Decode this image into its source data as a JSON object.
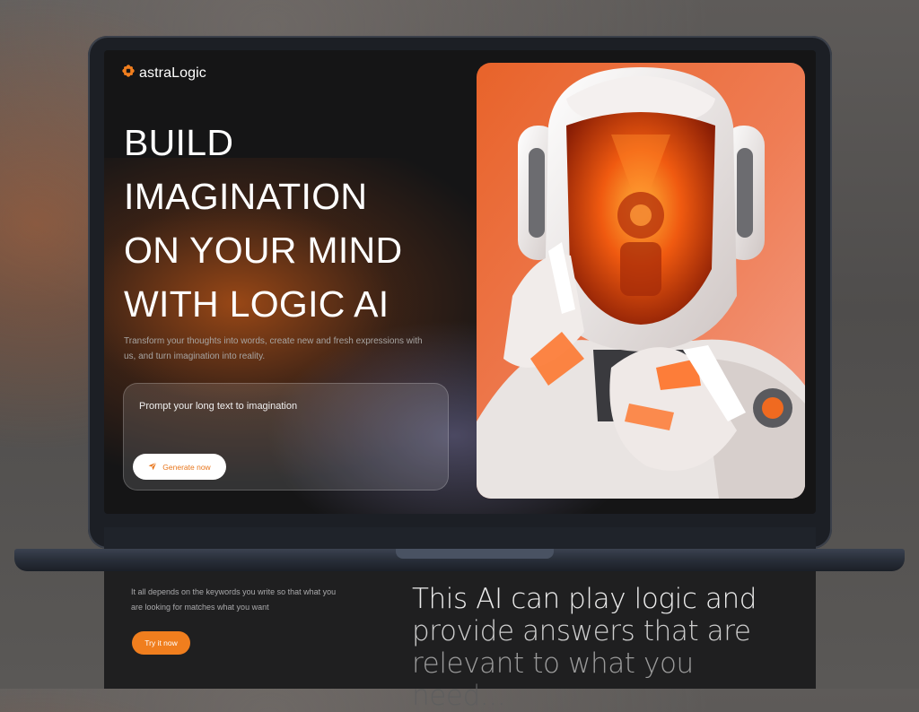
{
  "app": {
    "logo_text": "astraLogic",
    "logo_icon": "flower-sparkle-icon",
    "brand_color": "#f07e1e"
  },
  "hero": {
    "headline_lines": [
      "BUILD",
      "IMAGINATION",
      "ON YOUR MIND",
      "WITH LOGIC AI"
    ],
    "subtext": "Transform your thoughts into words, create new and fresh expressions with us, and turn imagination into reality.",
    "prompt_text": "Prompt your long text to imagination",
    "generate_label": "Generate now",
    "generate_icon": "send-icon"
  },
  "below": {
    "description": "It all depends on the keywords you write so that what you are looking for matches what you want",
    "try_label": "Try it now",
    "statement_lines": [
      "This AI can play logic and",
      "provide answers that are",
      "relevant to what you",
      "need..."
    ]
  }
}
